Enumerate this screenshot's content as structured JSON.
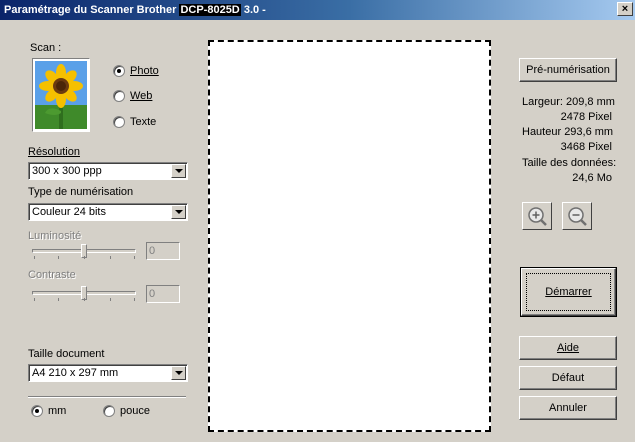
{
  "window": {
    "title_prefix": "Paramétrage du Scanner Brother ",
    "model": "DCP-8025D",
    "title_suffix": " 3.0 -",
    "close_glyph": "×"
  },
  "scan": {
    "label": "Scan :",
    "options": [
      {
        "label": "Photo",
        "selected": true
      },
      {
        "label": "Web",
        "selected": false
      },
      {
        "label": "Texte",
        "selected": false
      }
    ]
  },
  "resolution": {
    "label": "Résolution",
    "value": "300 x 300 ppp"
  },
  "scan_type": {
    "label": "Type de numérisation",
    "value": "Couleur 24 bits"
  },
  "brightness": {
    "label": "Luminosité",
    "value": "0",
    "level": 0.5
  },
  "contrast": {
    "label": "Contraste",
    "value": "0",
    "level": 0.5
  },
  "document_size": {
    "label": "Taille document",
    "value": "A4 210 x 297 mm"
  },
  "units": [
    {
      "label": "mm",
      "selected": true
    },
    {
      "label": "pouce",
      "selected": false
    }
  ],
  "prescan_button": "Pré-numérisation",
  "info": {
    "width_label": "Largeur: 209,8 mm",
    "width_px": "2478 Pixel",
    "height_label": "Hauteur 293,6 mm",
    "height_px": "3468 Pixel",
    "data_size_label": "Taille des données:",
    "data_size_value": "24,6 Mo"
  },
  "zoom_in_icon": "zoom-in-icon",
  "zoom_out_icon": "zoom-out-icon",
  "buttons": {
    "start": "Démarrer",
    "help": "Aide",
    "default": "Défaut",
    "cancel": "Annuler"
  }
}
